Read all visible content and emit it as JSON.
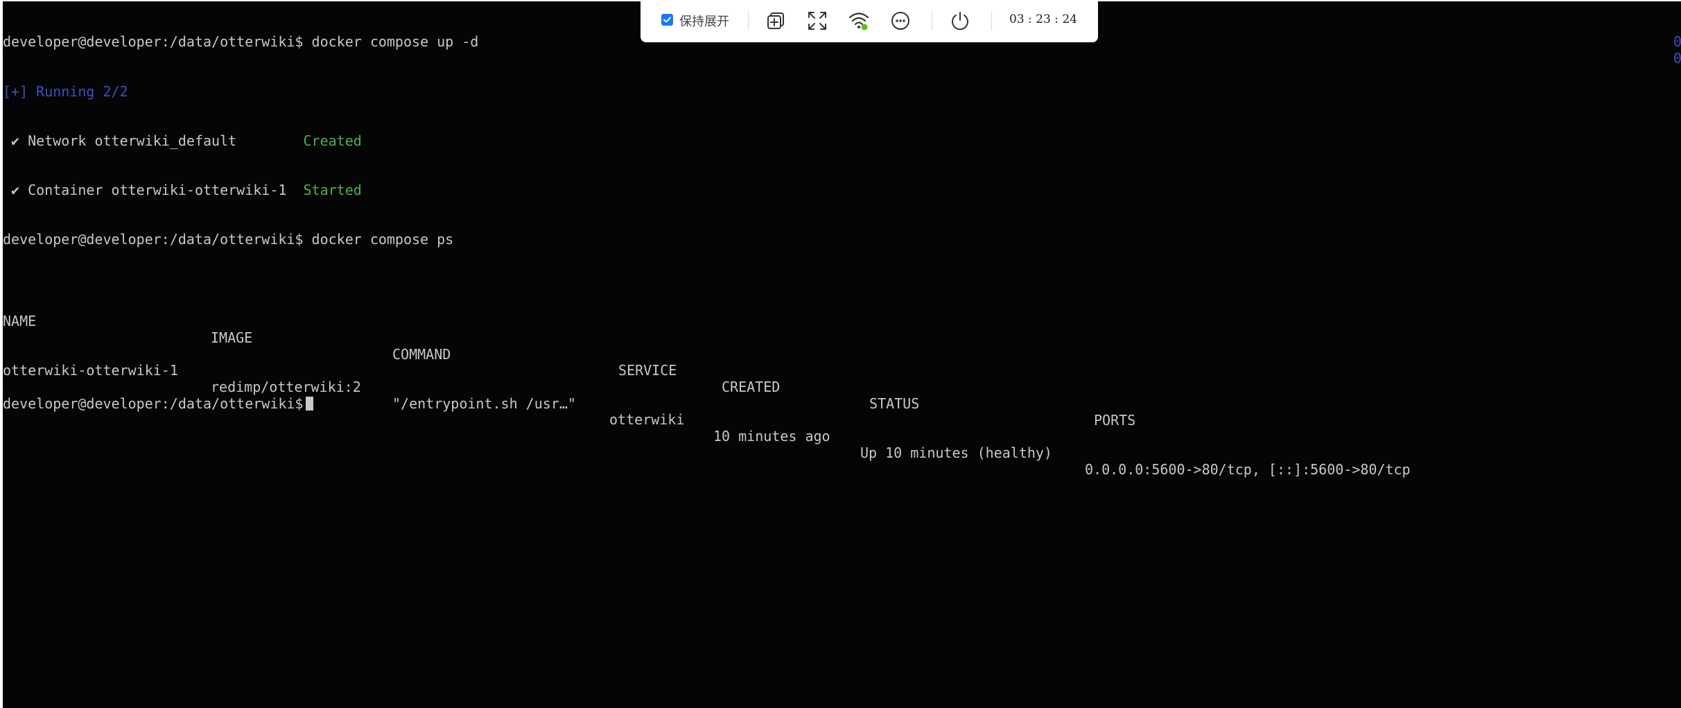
{
  "terminal": {
    "prompt": "developer@developer:/data/otterwiki$",
    "cmd1": " docker compose up -d",
    "running": "[+] Running 2/2",
    "net_line": " ✔ Network otterwiki_default        ",
    "net_status": "Created",
    "cont_line": " ✔ Container otterwiki-otterwiki-1  ",
    "cont_status": "Started",
    "cmd2": " docker compose ps",
    "right_marker_1": "0",
    "right_marker_2": "0",
    "table": {
      "headers": [
        "NAME",
        "IMAGE",
        "COMMAND",
        "SERVICE",
        "CREATED",
        "STATUS",
        "PORTS"
      ],
      "row": [
        "otterwiki-otterwiki-1",
        "redimp/otterwiki:2",
        "\"/entrypoint.sh /usr…\"",
        "otterwiki",
        "10 minutes ago",
        "Up 10 minutes (healthy)",
        "0.0.0.0:5600->80/tcp, [::]:5600->80/tcp"
      ]
    }
  },
  "toolbar": {
    "keep_expanded_label": "保持展开",
    "keep_expanded_checked": true,
    "icons": [
      "add-window-icon",
      "fullscreen-icon",
      "wifi-icon",
      "more-icon",
      "power-icon"
    ],
    "time": "03 : 23 : 24"
  },
  "colors": {
    "background": "#050505",
    "text": "#c8c8c8",
    "blue": "#3b4fc4",
    "green": "#4cb04c",
    "checkbox": "#1677ff",
    "wifi_dot": "#52c41a"
  }
}
